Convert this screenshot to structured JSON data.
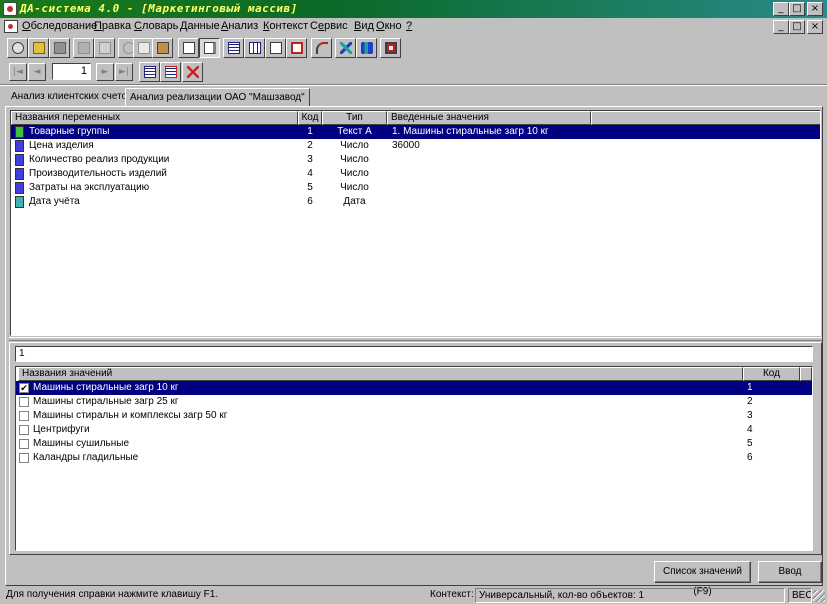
{
  "window": {
    "title": "ДА-система 4.0 - [Маркетинговый массив]",
    "min_label": "_",
    "max_label": "□",
    "close_label": "×",
    "child_min_label": "_",
    "child_restore_label": "ð",
    "child_close_label": "×"
  },
  "menu": {
    "items": [
      {
        "u": "О",
        "rest": "бследование"
      },
      {
        "u": "П",
        "rest": "равка"
      },
      {
        "u": "С",
        "rest": "ловарь"
      },
      {
        "u": "Д",
        "rest": "анные"
      },
      {
        "u": "А",
        "rest": "нализ"
      },
      {
        "u": "К",
        "rest": "онтекст"
      },
      {
        "pre": "С",
        "u": "е",
        "rest": "рвис"
      },
      {
        "u": "В",
        "rest": "ид"
      },
      {
        "u": "О",
        "rest": "кно"
      },
      {
        "u": "?",
        "rest": ""
      }
    ]
  },
  "navigator": {
    "record_value": "1",
    "first": "|◄",
    "prev": "◄",
    "next": "►",
    "last": "►|"
  },
  "tabs": [
    {
      "label": "Анализ клиентских счетов"
    },
    {
      "label": "Анализ реализации ОАО \"Машзавод\""
    }
  ],
  "variables": {
    "headers": {
      "name": "Названия переменных",
      "code": "Код",
      "type": "Тип",
      "values": "Введенные значения"
    },
    "rows": [
      {
        "name": "Товарные группы",
        "code": "1",
        "type": "Текст А",
        "value": "1. Машины стиральные загр 10 кг",
        "icon_color": "#40c040"
      },
      {
        "name": "Цена изделия",
        "code": "2",
        "type": "Число",
        "value": "36000",
        "icon_color": "#4040e0"
      },
      {
        "name": "Количество реализ продукции",
        "code": "3",
        "type": "Число",
        "value": "",
        "icon_color": "#4040e0"
      },
      {
        "name": "Производительность изделий",
        "code": "4",
        "type": "Число",
        "value": "",
        "icon_color": "#4040e0"
      },
      {
        "name": "Затраты на эксплуатацию",
        "code": "5",
        "type": "Число",
        "value": "",
        "icon_color": "#4040e0"
      },
      {
        "name": "Дата учёта",
        "code": "6",
        "type": "Дата",
        "value": "",
        "icon_color": "#40b0b0"
      }
    ]
  },
  "values_panel": {
    "search_value": "1",
    "headers": {
      "name": "Названия значений",
      "code": "Код"
    },
    "rows": [
      {
        "name": "Машины стиральные загр 10 кг",
        "code": "1",
        "checked": true
      },
      {
        "name": "Машины стиральные загр 25 кг",
        "code": "2",
        "checked": false
      },
      {
        "name": "Машины стиральн и комплексы загр 50 кг",
        "code": "3",
        "checked": false
      },
      {
        "name": "Центрифуги",
        "code": "4",
        "checked": false
      },
      {
        "name": "Машины сушильные",
        "code": "5",
        "checked": false
      },
      {
        "name": "Каландры гладильные",
        "code": "6",
        "checked": false
      }
    ]
  },
  "buttons": {
    "values_list": "Список значений (F9)",
    "enter": "Ввод"
  },
  "status": {
    "help": "Для получения справки нажмите клавишу F1.",
    "context_label": "Контекст:",
    "context_value": "Универсальный, кол-во объектов: 1",
    "mode": "ВЕС"
  },
  "colors": {
    "selection": "#000080",
    "face": "#c0c0c0",
    "title_text": "#ffff66"
  }
}
